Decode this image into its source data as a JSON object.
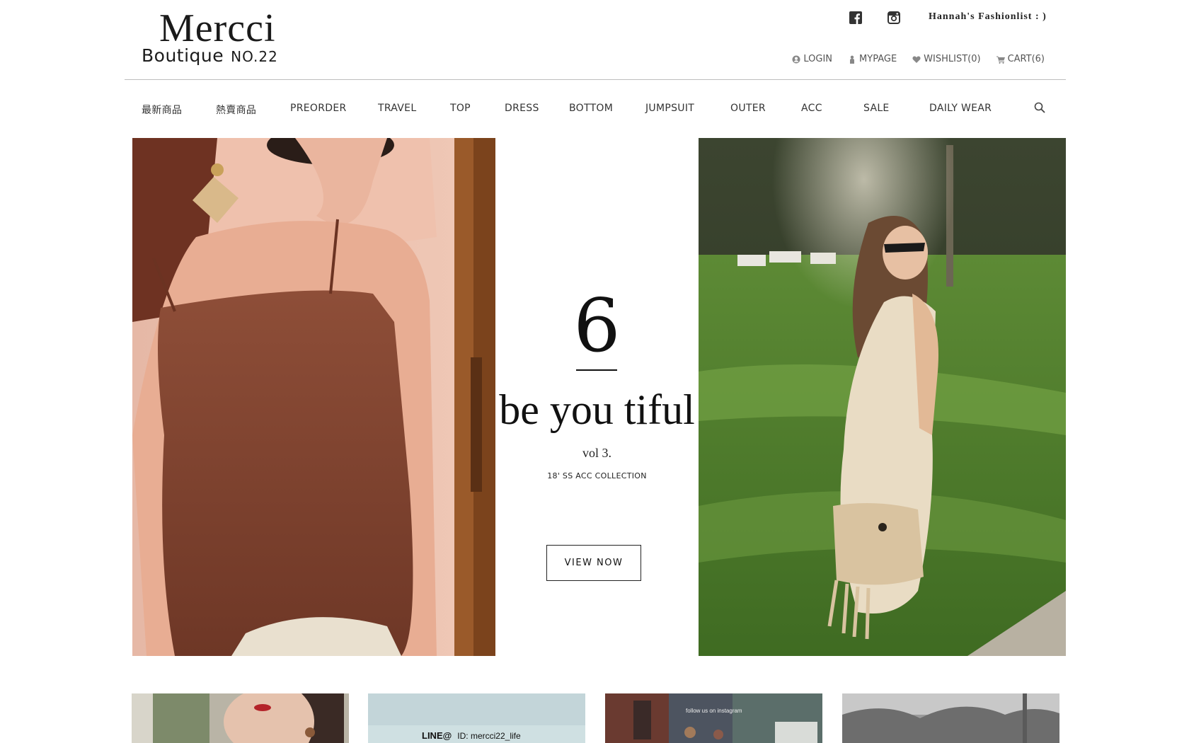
{
  "brand": {
    "name": "Mercci",
    "sub": "Boutique",
    "number": "NO.22"
  },
  "header": {
    "social": [
      {
        "icon": "facebook-icon"
      },
      {
        "icon": "instagram-icon"
      }
    ],
    "fashionlist": "Hannah's Fashionlist : )",
    "user_links": [
      {
        "label": "LOGIN",
        "icon": "user-icon"
      },
      {
        "label": "MYPAGE",
        "icon": "person-icon"
      },
      {
        "label": "WISHLIST(0)",
        "icon": "heart-icon"
      },
      {
        "label": "CART(6)",
        "icon": "cart-icon"
      }
    ]
  },
  "nav": {
    "items": [
      "最新商品",
      "熱賣商品",
      "PREORDER",
      "TRAVEL",
      "TOP",
      "DRESS",
      "BOTTOM",
      "JUMPSUIT",
      "OUTER",
      "ACC",
      "SALE",
      "DAILY WEAR"
    ],
    "search_icon": "search-icon"
  },
  "hero": {
    "number": "6",
    "headline": "be you tiful",
    "volume": "vol 3.",
    "collection": "18' SS ACC COLLECTION",
    "cta": "VIEW NOW"
  },
  "thumbs": {
    "line_brand": "LINE@",
    "line_id": "ID: mercci22_life",
    "instagram_caption": "follow us on instagram"
  },
  "colors": {
    "text": "#222222",
    "divider": "#bdbdbd",
    "background": "#ffffff"
  }
}
